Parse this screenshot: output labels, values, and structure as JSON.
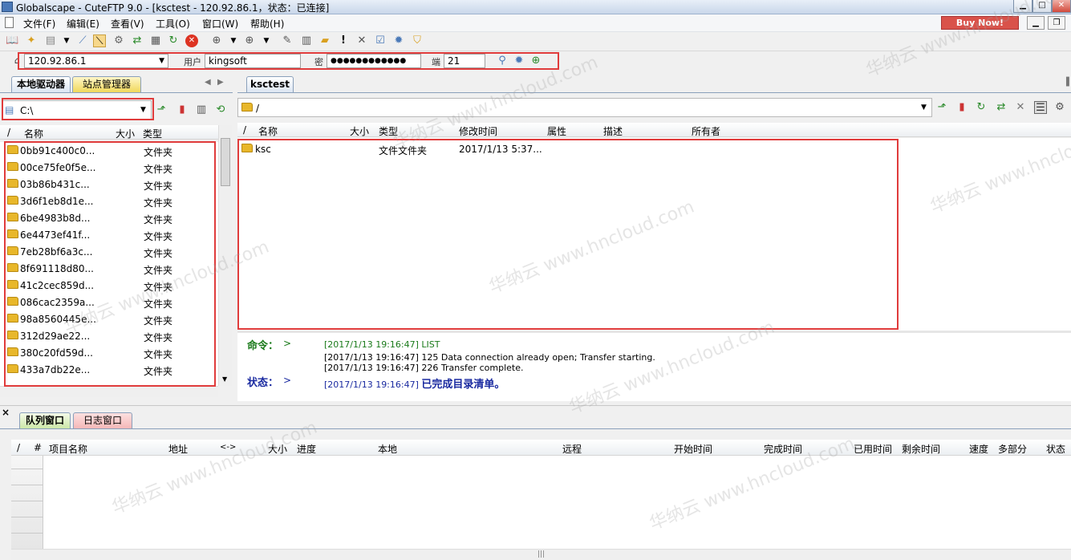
{
  "window": {
    "title": "Globalscape - CuteFTP 9.0 - [ksctest - 120.92.86.1，状态：已连接]"
  },
  "menu": {
    "items": [
      "文件(F)",
      "编辑(E)",
      "查看(V)",
      "工具(O)",
      "窗口(W)",
      "帮助(H)"
    ],
    "buy_now": "Buy Now!"
  },
  "quick_connect": {
    "host": "120.92.86.1",
    "user_label": "用户",
    "user": "kingsoft",
    "password_label": "密",
    "password": "●●●●●●●●●●●●",
    "port_label": "端",
    "port": "21"
  },
  "left_pane": {
    "tabs": [
      "本地驱动器",
      "站点管理器"
    ],
    "path": "C:\\",
    "columns": [
      "/",
      "名称",
      "大小",
      "类型"
    ],
    "rows": [
      {
        "name": "0bb91c400c0...",
        "type": "文件夹"
      },
      {
        "name": "00ce75fe0f5e...",
        "type": "文件夹"
      },
      {
        "name": "03b86b431c...",
        "type": "文件夹"
      },
      {
        "name": "3d6f1eb8d1e...",
        "type": "文件夹"
      },
      {
        "name": "6be4983b8d...",
        "type": "文件夹"
      },
      {
        "name": "6e4473ef41f...",
        "type": "文件夹"
      },
      {
        "name": "7eb28bf6a3c...",
        "type": "文件夹"
      },
      {
        "name": "8f691118d80...",
        "type": "文件夹"
      },
      {
        "name": "41c2cec859d...",
        "type": "文件夹"
      },
      {
        "name": "086cac2359a...",
        "type": "文件夹"
      },
      {
        "name": "98a8560445e...",
        "type": "文件夹"
      },
      {
        "name": "312d29ae22...",
        "type": "文件夹"
      },
      {
        "name": "380c20fd59d...",
        "type": "文件夹"
      },
      {
        "name": "433a7db22e...",
        "type": "文件夹"
      }
    ]
  },
  "right_pane": {
    "tab": "ksctest",
    "path": "/",
    "columns": [
      "/",
      "名称",
      "大小",
      "类型",
      "修改时间",
      "属性",
      "描述",
      "所有者"
    ],
    "rows": [
      {
        "name": "ksc",
        "type": "文件文件夹",
        "modified": "2017/1/13 5:37..."
      }
    ]
  },
  "log": {
    "command_label": "命令：",
    "status_label": "状态：",
    "prompt": ">",
    "lines": [
      {
        "time": "[2017/1/13 19:16:47]",
        "text": "LIST"
      },
      {
        "time": "[2017/1/13 19:16:47]",
        "text": "125 Data connection already open; Transfer starting."
      },
      {
        "time": "[2017/1/13 19:16:47]",
        "text": "226 Transfer complete."
      }
    ],
    "status_line": {
      "time": "[2017/1/13 19:16:47]",
      "text": "已完成目录清单。"
    }
  },
  "queue": {
    "close_glyph": "×",
    "tabs": [
      "队列窗口",
      "日志窗口"
    ],
    "columns": [
      "/",
      "#",
      "项目名称",
      "地址",
      "<->",
      "大小",
      "进度",
      "本地",
      "远程",
      "开始时间",
      "完成时间",
      "已用时间",
      "剩余时间",
      "速度",
      "多部分",
      "状态"
    ]
  },
  "watermark_text": "华纳云 www.hncloud.com"
}
